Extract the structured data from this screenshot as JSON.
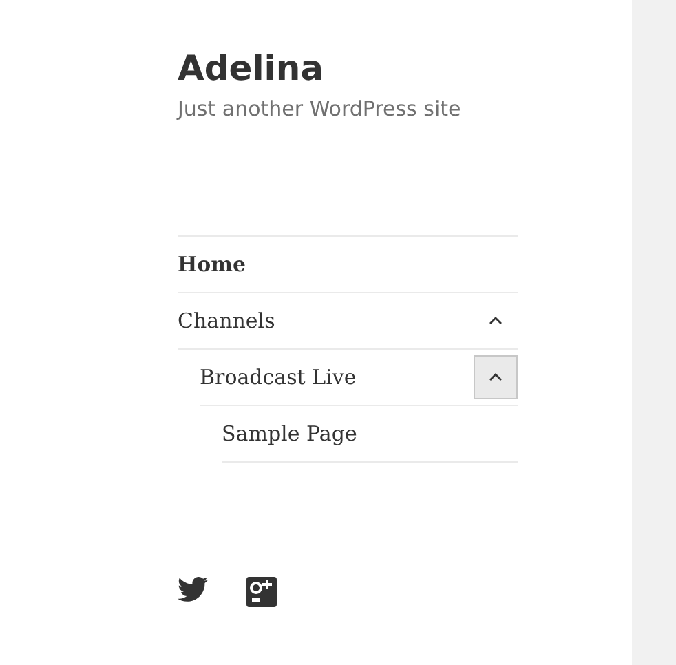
{
  "site": {
    "title": "Adelina",
    "tagline": "Just another WordPress site"
  },
  "menu": [
    {
      "label": "Home",
      "selected": true
    },
    {
      "label": "Channels",
      "selected": false,
      "expanded": true,
      "focused": false,
      "children": [
        {
          "label": "Broadcast Live",
          "selected": false,
          "expanded": true,
          "focused": true,
          "children": [
            {
              "label": "Sample Page",
              "selected": false
            }
          ]
        }
      ]
    }
  ],
  "social": [
    {
      "kind": "bird"
    },
    {
      "kind": "square-plus"
    }
  ]
}
